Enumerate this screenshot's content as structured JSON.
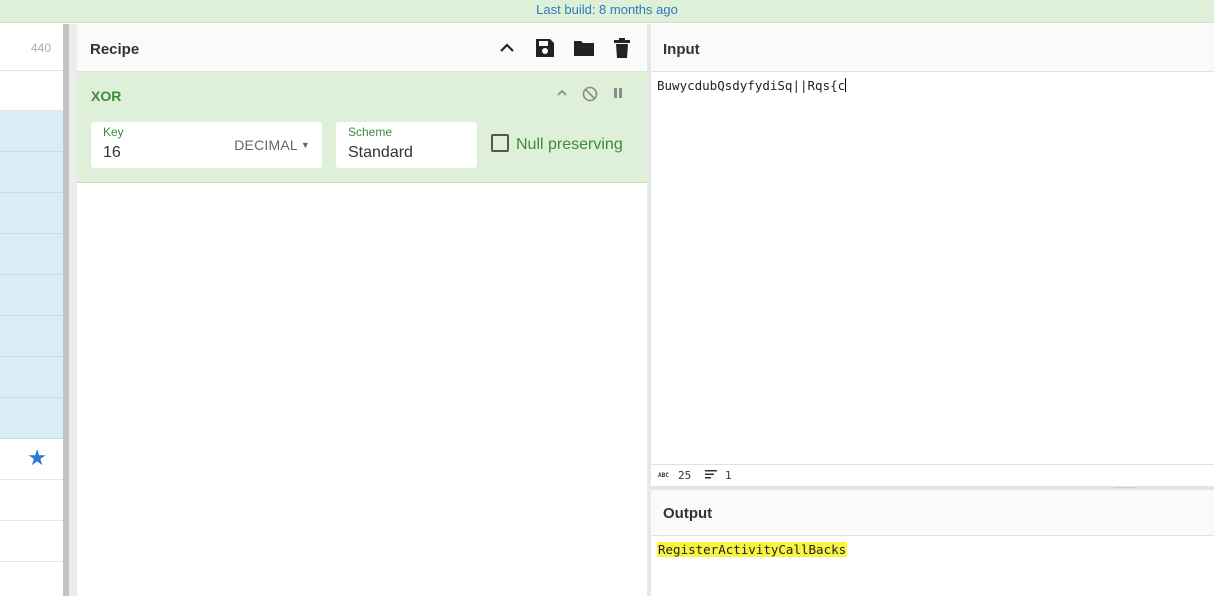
{
  "banner": {
    "text": "Last build: 8 months ago"
  },
  "operations": {
    "count": "440"
  },
  "recipe": {
    "title": "Recipe",
    "tool_icons": [
      "chevron-up-icon",
      "save-icon",
      "folder-icon",
      "trash-icon"
    ],
    "op": {
      "name": "XOR",
      "key": {
        "label": "Key",
        "value": "16",
        "format": "DECIMAL"
      },
      "scheme": {
        "label": "Scheme",
        "value": "Standard"
      },
      "null_preserving": {
        "label": "Null preserving",
        "checked": false
      }
    }
  },
  "input": {
    "title": "Input",
    "text": "BuwycdubQsdyfydiSq||Rqs{c",
    "status": {
      "length_label": "ABC",
      "length": "25",
      "lines": "1"
    }
  },
  "output": {
    "title": "Output",
    "text": "RegisterActivityCallBacks"
  },
  "colors": {
    "accent_green": "#3c8b3c",
    "op_bg": "#dff0d8",
    "highlight": "#f8f43f",
    "star": "#2a7fd1"
  }
}
